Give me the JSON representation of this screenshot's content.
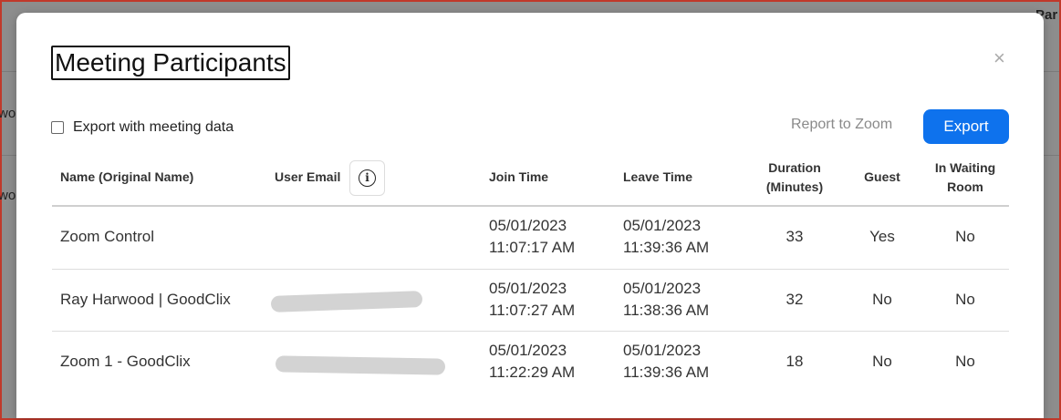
{
  "background": {
    "top_right_text": "Par",
    "left_text_1": "wo",
    "left_text_2": "wo"
  },
  "modal": {
    "title": "Meeting Participants",
    "close_label": "×",
    "export_checkbox_label": "Export with meeting data",
    "export_checkbox_checked": false,
    "report_link": "Report to Zoom",
    "export_button": "Export",
    "accent_color": "#0e72ed"
  },
  "table": {
    "headers": {
      "name": "Name (Original Name)",
      "email": "User Email",
      "join": "Join Time",
      "leave": "Leave Time",
      "duration_1": "Duration",
      "duration_2": "(Minutes)",
      "guest": "Guest",
      "waiting_1": "In Waiting",
      "waiting_2": "Room"
    },
    "info_icon": "i",
    "rows": [
      {
        "name": "Zoom Control",
        "email": "",
        "join_date": "05/01/2023",
        "join_time": "11:07:17 AM",
        "leave_date": "05/01/2023",
        "leave_time": "11:39:36 AM",
        "duration": "33",
        "guest": "Yes",
        "waiting": "No"
      },
      {
        "name": "Ray Harwood | GoodClix",
        "email": "[redacted]",
        "join_date": "05/01/2023",
        "join_time": "11:07:27 AM",
        "leave_date": "05/01/2023",
        "leave_time": "11:38:36 AM",
        "duration": "32",
        "guest": "No",
        "waiting": "No"
      },
      {
        "name": "Zoom 1 - GoodClix",
        "email": "[redacted]",
        "join_date": "05/01/2023",
        "join_time": "11:22:29 AM",
        "leave_date": "05/01/2023",
        "leave_time": "11:39:36 AM",
        "duration": "18",
        "guest": "No",
        "waiting": "No"
      }
    ]
  }
}
